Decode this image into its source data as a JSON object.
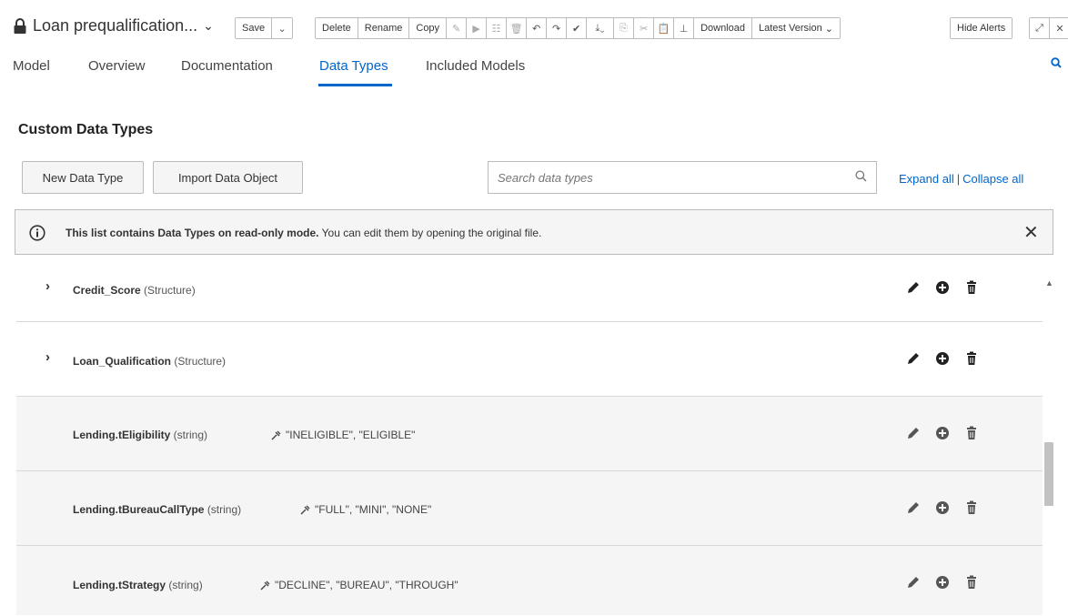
{
  "header": {
    "title": "Loan prequalification...",
    "toolbar": {
      "save": "Save",
      "delete": "Delete",
      "rename": "Rename",
      "copy": "Copy",
      "download": "Download",
      "latest_version": "Latest Version",
      "hide_alerts": "Hide Alerts"
    }
  },
  "tabs": [
    {
      "label": "Model"
    },
    {
      "label": "Overview"
    },
    {
      "label": "Documentation"
    },
    {
      "label": "Data Types",
      "active": true
    },
    {
      "label": "Included Models"
    }
  ],
  "main": {
    "section_title": "Custom Data Types",
    "new_button": "New Data Type",
    "import_button": "Import Data Object",
    "search_placeholder": "Search data types",
    "expand_all": "Expand all",
    "separator": "|",
    "collapse_all": "Collapse all",
    "alert": {
      "bold": "This list contains Data Types on read-only mode.",
      "rest": " You can edit them by opening the original file."
    },
    "rows": [
      {
        "name": "Credit_Score",
        "type": "(Structure)"
      },
      {
        "name": "Loan_Qualification",
        "type": "(Structure)"
      },
      {
        "name": "Lending.tEligibility",
        "type": "(string)",
        "constraint": "\"INELIGIBLE\", \"ELIGIBLE\""
      },
      {
        "name": "Lending.tBureauCallType",
        "type": "(string)",
        "constraint": "\"FULL\", \"MINI\", \"NONE\""
      },
      {
        "name": "Lending.tStrategy",
        "type": "(string)",
        "constraint": "\"DECLINE\", \"BUREAU\", \"THROUGH\""
      }
    ]
  },
  "colors": {
    "accent": "#0066cc",
    "row_child_bg": "#f5f5f5",
    "border": "#bbbbbb"
  }
}
